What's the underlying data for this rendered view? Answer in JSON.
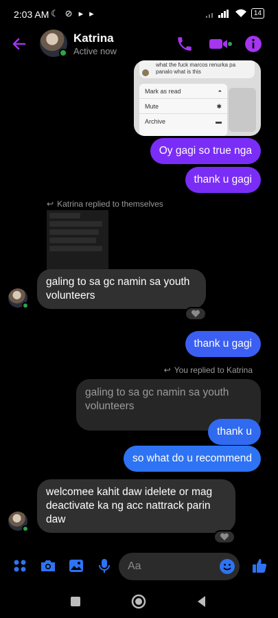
{
  "status_bar": {
    "time": "2:03 AM",
    "battery": "14"
  },
  "header": {
    "name": "Katrina",
    "status": "Active now"
  },
  "colors": {
    "accent_purple": "#7a2df7",
    "accent_blue": "#2e6ff4",
    "bubble_in": "#303030",
    "online": "#31a24c"
  },
  "shared_screenshot": {
    "text": "what the fuck marcos renurka pa panalo what is this",
    "menu": [
      "Mark as read",
      "Mute",
      "Archive"
    ]
  },
  "messages": {
    "m1": "Oy gagi so true nga",
    "m2": "thank u gagi",
    "reply_note_1": "Katrina replied to themselves",
    "m3": "galing to sa gc namin sa youth volunteers",
    "m4": "thank u gagi",
    "reply_note_2": "You replied to Katrina",
    "m5_quote": "galing to sa gc namin sa youth volunteers",
    "m6": "thank u",
    "m7": "so what do u recommend",
    "m8": "welcomee kahit daw idelete or mag deactivate ka ng acc nattrack parin daw"
  },
  "composer": {
    "placeholder": "Aa"
  },
  "icons": [
    "back-arrow-icon",
    "phone-icon",
    "video-icon",
    "info-icon",
    "menu-dots-icon",
    "camera-icon",
    "image-icon",
    "mic-icon",
    "emoji-icon",
    "like-icon",
    "reply-arrow-icon",
    "heart-icon",
    "square-nav-icon",
    "home-nav-icon",
    "back-nav-icon"
  ]
}
